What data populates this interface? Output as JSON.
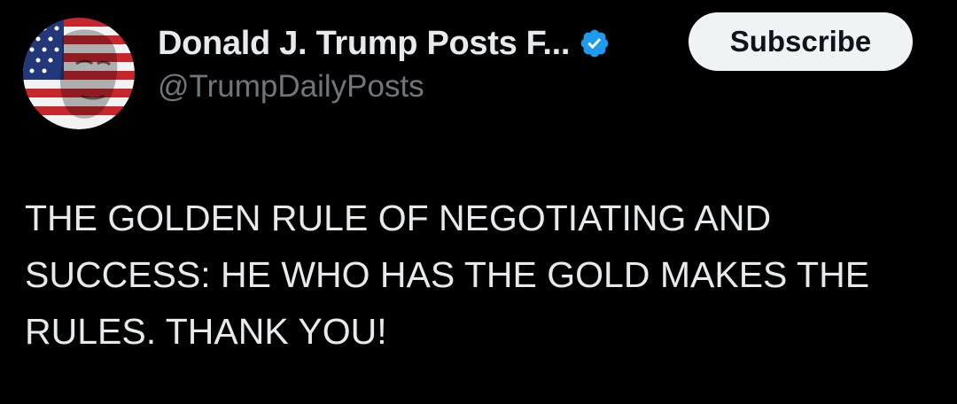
{
  "author": {
    "display_name": "Donald J. Trump Posts F...",
    "handle": "@TrumpDailyPosts",
    "verified": true,
    "avatar_icon": "flag-portrait-avatar",
    "verified_icon": "verified-badge-icon",
    "verified_color": "#1d9bf0"
  },
  "actions": {
    "subscribe_label": "Subscribe"
  },
  "post": {
    "text": "THE GOLDEN RULE OF NEGOTIATING AND SUCCESS: HE WHO HAS THE GOLD MAKES THE RULES. THANK YOU!"
  },
  "colors": {
    "background": "#000000",
    "primary_text": "#e7e9ea",
    "secondary_text": "#71767b",
    "button_bg": "#eff3f4",
    "button_text": "#0f1419"
  }
}
